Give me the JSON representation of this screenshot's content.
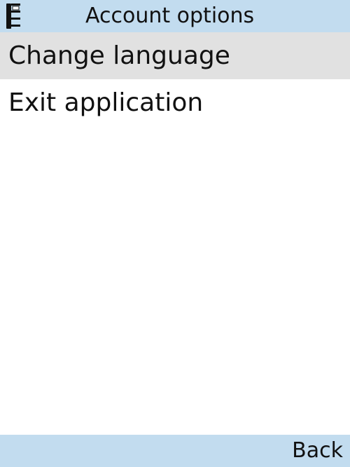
{
  "header": {
    "icon": "app-shortcut-icon",
    "title": "Account options"
  },
  "menu": {
    "selected_index": 0,
    "items": [
      {
        "label": "Change language"
      },
      {
        "label": "Exit application"
      }
    ]
  },
  "softkeys": {
    "right_label": "Back"
  },
  "colors": {
    "bar_background": "#c2dcef",
    "selection_background": "#e1e1e1",
    "content_background": "#ffffff",
    "text": "#111111"
  }
}
